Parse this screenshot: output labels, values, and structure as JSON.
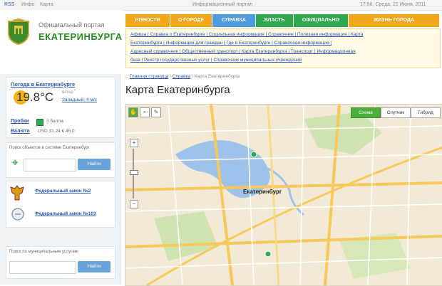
{
  "topbar": {
    "left1": "RSS",
    "left2": "Инфо",
    "left3": "Карта",
    "center": "Информационный портал",
    "right_date": "17:58, Среда, 21 Июня, 2011"
  },
  "header": {
    "title_small": "Официальный портал",
    "title_big": "ЕКАТЕРИНБУРГА"
  },
  "nav": {
    "tabs": [
      {
        "label": "НОВОСТИ",
        "color": "#f0a81a"
      },
      {
        "label": "О ГОРОДЕ",
        "color": "#f0a81a"
      },
      {
        "label": "СПРАВКА",
        "color": "#4e9be0"
      },
      {
        "label": "ВЛАСТЬ",
        "color": "#2fa84f"
      },
      {
        "label": "ОФИЦИАЛЬНО",
        "color": "#2fa84f"
      },
      {
        "label": "ЖИЗНЬ ГОРОДА",
        "color": "#f0a81a"
      }
    ]
  },
  "links": {
    "line1": "Афиша | Справка о Екатеринбурге | Социальная информация | Справочник | Полезная информация | Карта",
    "line2": "Екатеринбурга | Информация для граждан | Где в Екатеринбурге | Справочная информация |",
    "line3": "Адресный справочник | Общественный транспорт | Карта Екатеринбурга | Транспорт | Информационная",
    "line4": "база | Реестр государственных услуг | Справочник муниципальных учреждений"
  },
  "sidebar": {
    "weather_title": "Погода в Екатеринбурге",
    "temperature": "19.8°C",
    "wind_label": "ветер",
    "wind_value": "Западный, 4 м/с",
    "traffic_label": "Пробки",
    "traffic_value": "3 балла",
    "currency_label": "Валюта",
    "currency_value": "USD 31.24   € 45.0",
    "search_title": "Поиск объектов в системе Екатеринбург",
    "search_button": "Найти",
    "fed_link1": "Федеральный закон №2",
    "fed_link2": "Федеральный закон №103",
    "muni_title": "Поиск по муниципальным услугам",
    "muni_button": "Найти"
  },
  "main": {
    "crumb_home": "Главная страница",
    "crumb_sep1": "/",
    "crumb_ref": "Справка",
    "crumb_sep2": "/",
    "crumb_current": "Карта Екатеринбурга",
    "page_title": "Карта Екатеринбурга",
    "map": {
      "btn_scheme": "Схема",
      "btn_satellite": "Спутник",
      "btn_hybrid": "Гибрид",
      "city_label": "Екатеринбург",
      "zoom_plus": "+",
      "zoom_minus": "−"
    }
  }
}
